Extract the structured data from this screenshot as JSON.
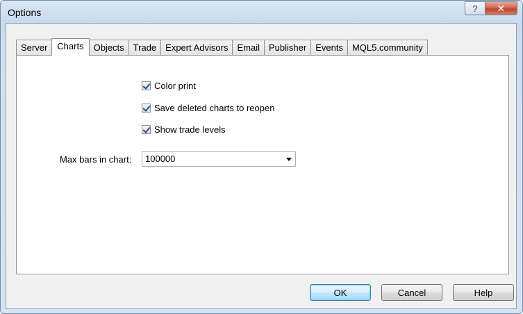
{
  "window": {
    "title": "Options",
    "help_glyph": "?",
    "close_glyph": "✕"
  },
  "tabs": [
    {
      "label": "Server",
      "active": false
    },
    {
      "label": "Charts",
      "active": true
    },
    {
      "label": "Objects",
      "active": false
    },
    {
      "label": "Trade",
      "active": false
    },
    {
      "label": "Expert Advisors",
      "active": false
    },
    {
      "label": "Email",
      "active": false
    },
    {
      "label": "Publisher",
      "active": false
    },
    {
      "label": "Events",
      "active": false
    },
    {
      "label": "MQL5.community",
      "active": false
    }
  ],
  "charts_tab": {
    "color_print": {
      "label": "Color print",
      "checked": true
    },
    "save_deleted": {
      "label": "Save deleted charts to reopen",
      "checked": true
    },
    "show_trade_levels": {
      "label": "Show trade levels",
      "checked": true
    },
    "max_bars_label": "Max bars in chart:",
    "max_bars_value": "100000"
  },
  "buttons": {
    "ok": "OK",
    "cancel": "Cancel",
    "help": "Help"
  },
  "icons": {
    "help": "help-question-icon",
    "close": "close-icon",
    "dropdown": "chevron-down-icon",
    "check": "checkmark-icon"
  },
  "colors": {
    "titlebar": "#c7d9ec",
    "close_button": "#c0432c",
    "default_button": "#bee6fd"
  }
}
